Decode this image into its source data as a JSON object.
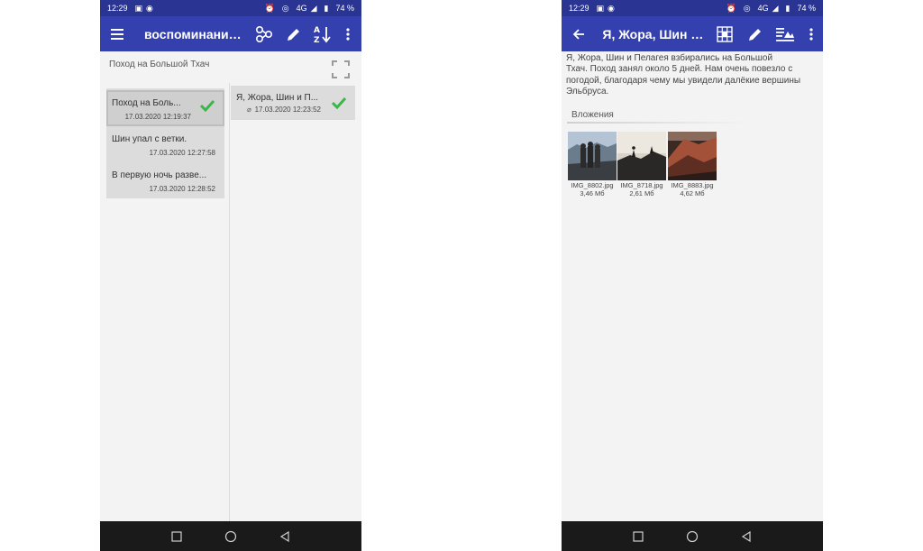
{
  "status_bar": {
    "time": "12:29",
    "network": "4G",
    "battery": "74 %"
  },
  "left_screen": {
    "app_bar": {
      "title": "воспоминания..."
    },
    "path_label": "Поход на Большой Тхач",
    "notes": [
      {
        "name": "Поход на Боль...",
        "date": "17.03.2020 12:19:37",
        "selected": true
      },
      {
        "name": "Шин упал с ветки.",
        "date": "17.03.2020 12:27:58",
        "selected": false
      },
      {
        "name": "В первую ночь разве...",
        "date": "17.03.2020 12:28:52",
        "selected": false
      }
    ],
    "subnotes": [
      {
        "name": "Я, Жора, Шин и П...",
        "date": "17.03.2020 12:23:52",
        "has_attachment": true
      }
    ]
  },
  "right_screen": {
    "app_bar": {
      "title": "Я, Жора, Шин и..."
    },
    "body_lines": [
      "Я, Жора, Шин и Пелагея взбирались на Большой",
      "Тхач. Поход занял около 5 дней. Нам очень повезло с",
      "погодой, благодаря чему мы увидели далёкие вершины",
      "Эльбруса."
    ],
    "attachments_label": "Вложения",
    "attachments": [
      {
        "name": "IMG_8802.jpg",
        "size": "3,46 Мб"
      },
      {
        "name": "IMG_8718.jpg",
        "size": "2,61 Мб"
      },
      {
        "name": "IMG_8883.jpg",
        "size": "4,62 Мб"
      }
    ]
  },
  "colors": {
    "app_bar": "#3440ad",
    "status_bar": "#2a3493",
    "check": "#3cb54a",
    "nav_bar": "#1a1a1a"
  }
}
